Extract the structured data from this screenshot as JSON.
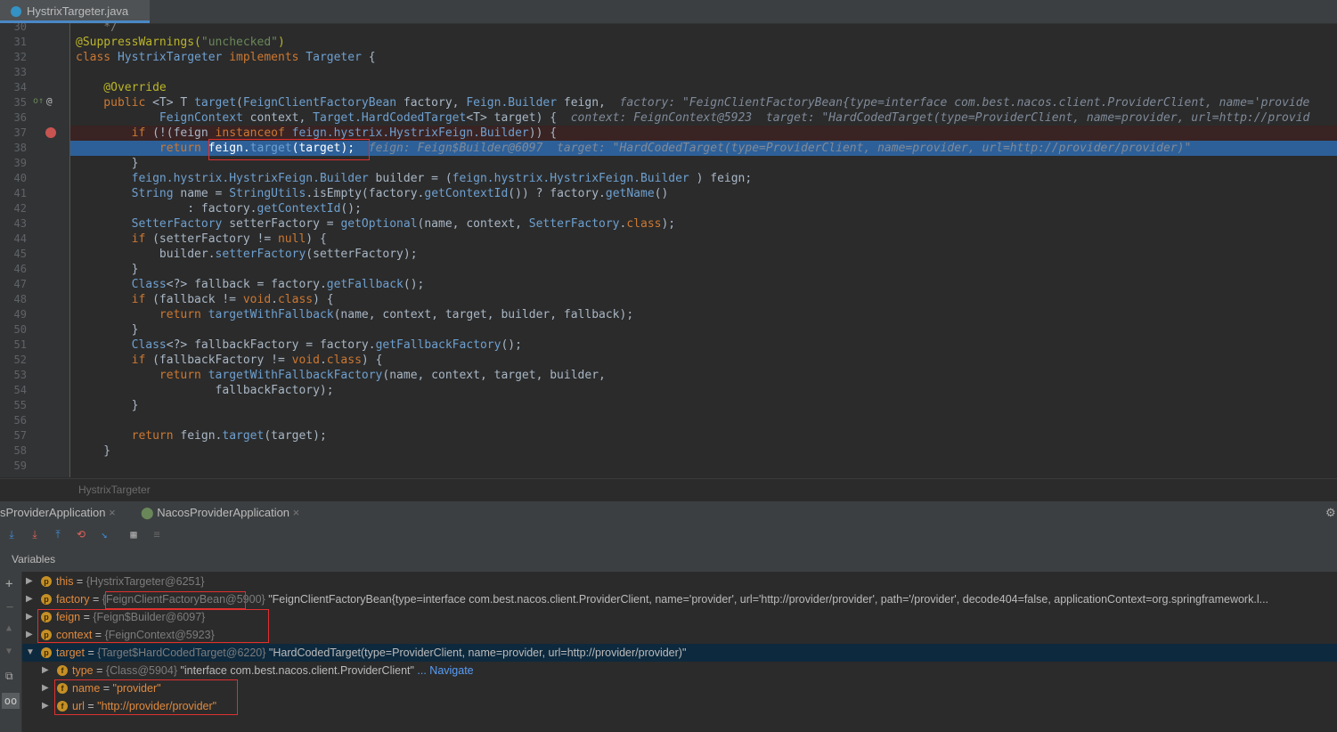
{
  "tab": {
    "file": "HystrixTargeter.java"
  },
  "lines": [
    {
      "n": "30",
      "parts": [
        [
          "cm",
          "    */"
        ]
      ]
    },
    {
      "n": "31",
      "parts": [
        [
          "an",
          "@SuppressWarnings("
        ],
        [
          "st",
          "\"unchecked\""
        ],
        [
          "an",
          ")"
        ]
      ]
    },
    {
      "n": "32",
      "parts": [
        [
          "kw",
          "class "
        ],
        [
          "ty2",
          "HystrixTargeter "
        ],
        [
          "kw",
          "implements "
        ],
        [
          "ty2",
          "Targeter "
        ],
        [
          "",
          "{"
        ]
      ]
    },
    {
      "n": "33",
      "parts": []
    },
    {
      "n": "34",
      "parts": [
        [
          "an",
          "    @Override"
        ]
      ]
    },
    {
      "n": "35",
      "parts": [
        [
          "kw",
          "    public "
        ],
        [
          "",
          "<T> T "
        ],
        [
          "ty2",
          "target"
        ],
        [
          "",
          "("
        ],
        [
          "ty2",
          "FeignClientFactoryBean"
        ],
        [
          "",
          " factory, "
        ],
        [
          "ty2",
          "Feign.Builder"
        ],
        [
          "",
          " feign,  "
        ],
        [
          "hint",
          "factory: \"FeignClientFactoryBean{type=interface com.best.nacos.client.ProviderClient, name='provide"
        ]
      ]
    },
    {
      "n": "36",
      "parts": [
        [
          "",
          "            "
        ],
        [
          "ty2",
          "FeignContext"
        ],
        [
          "",
          " context, "
        ],
        [
          "ty2",
          "Target.HardCodedTarget"
        ],
        [
          "",
          "<T> target) {  "
        ],
        [
          "hint",
          "context: FeignContext@5923  target: \"HardCodedTarget(type=ProviderClient, name=provider, url=http://provid"
        ]
      ]
    },
    {
      "n": "37",
      "parts": [
        [
          "kw",
          "        if "
        ],
        [
          "",
          "(!(feign "
        ],
        [
          "kw",
          "instanceof "
        ],
        [
          "ty2",
          "feign.hystrix.HystrixFeign.Builder"
        ],
        [
          "",
          ")) {"
        ]
      ]
    },
    {
      "n": "38",
      "parts": [
        [
          "kw",
          "            return "
        ],
        [
          "",
          "feign."
        ],
        [
          "ty2",
          "target"
        ],
        [
          "",
          "(target);  "
        ],
        [
          "hint",
          "feign: Feign$Builder@6097  target: \"HardCodedTarget(type=ProviderClient, name=provider, url=http://provider/provider)\""
        ]
      ]
    },
    {
      "n": "39",
      "parts": [
        [
          "",
          "        }"
        ]
      ]
    },
    {
      "n": "40",
      "parts": [
        [
          "",
          "        "
        ],
        [
          "ty2",
          "feign.hystrix.HystrixFeign.Builder"
        ],
        [
          "",
          " builder = ("
        ],
        [
          "ty2",
          "feign.hystrix.HystrixFeign.Builder"
        ],
        [
          "",
          " ) feign;"
        ]
      ]
    },
    {
      "n": "41",
      "parts": [
        [
          "",
          "        "
        ],
        [
          "ty2",
          "String"
        ],
        [
          "",
          " name = "
        ],
        [
          "ty2",
          "StringUtils"
        ],
        [
          "",
          ".isEmpty(factory."
        ],
        [
          "ty2",
          "getContextId"
        ],
        [
          "",
          "()) ? factory."
        ],
        [
          "ty2",
          "getName"
        ],
        [
          "",
          "()"
        ]
      ]
    },
    {
      "n": "42",
      "parts": [
        [
          "",
          "                : factory."
        ],
        [
          "ty2",
          "getContextId"
        ],
        [
          "",
          "();"
        ]
      ]
    },
    {
      "n": "43",
      "parts": [
        [
          "",
          "        "
        ],
        [
          "ty2",
          "SetterFactory"
        ],
        [
          "",
          " setterFactory = "
        ],
        [
          "ty2",
          "getOptional"
        ],
        [
          "",
          "(name, context, "
        ],
        [
          "ty2",
          "SetterFactory"
        ],
        [
          "",
          "."
        ],
        [
          "kw",
          "class"
        ],
        [
          "",
          ");"
        ]
      ]
    },
    {
      "n": "44",
      "parts": [
        [
          "kw",
          "        if "
        ],
        [
          "",
          "(setterFactory != "
        ],
        [
          "kw",
          "null"
        ],
        [
          "",
          ") {"
        ]
      ]
    },
    {
      "n": "45",
      "parts": [
        [
          "",
          "            builder."
        ],
        [
          "ty2",
          "setterFactory"
        ],
        [
          "",
          "(setterFactory);"
        ]
      ]
    },
    {
      "n": "46",
      "parts": [
        [
          "",
          "        }"
        ]
      ]
    },
    {
      "n": "47",
      "parts": [
        [
          "",
          "        "
        ],
        [
          "ty2",
          "Class"
        ],
        [
          "",
          "<?> fallback = factory."
        ],
        [
          "ty2",
          "getFallback"
        ],
        [
          "",
          "();"
        ]
      ]
    },
    {
      "n": "48",
      "parts": [
        [
          "kw",
          "        if "
        ],
        [
          "",
          "(fallback != "
        ],
        [
          "kw",
          "void"
        ],
        [
          "",
          "."
        ],
        [
          "kw",
          "class"
        ],
        [
          "",
          ") {"
        ]
      ]
    },
    {
      "n": "49",
      "parts": [
        [
          "kw",
          "            return "
        ],
        [
          "ty2",
          "targetWithFallback"
        ],
        [
          "",
          "(name, context, target, builder, fallback);"
        ]
      ]
    },
    {
      "n": "50",
      "parts": [
        [
          "",
          "        }"
        ]
      ]
    },
    {
      "n": "51",
      "parts": [
        [
          "",
          "        "
        ],
        [
          "ty2",
          "Class"
        ],
        [
          "",
          "<?> fallbackFactory = factory."
        ],
        [
          "ty2",
          "getFallbackFactory"
        ],
        [
          "",
          "();"
        ]
      ]
    },
    {
      "n": "52",
      "parts": [
        [
          "kw",
          "        if "
        ],
        [
          "",
          "(fallbackFactory != "
        ],
        [
          "kw",
          "void"
        ],
        [
          "",
          "."
        ],
        [
          "kw",
          "class"
        ],
        [
          "",
          ") {"
        ]
      ]
    },
    {
      "n": "53",
      "parts": [
        [
          "kw",
          "            return "
        ],
        [
          "ty2",
          "targetWithFallbackFactory"
        ],
        [
          "",
          "(name, context, target, builder,"
        ]
      ]
    },
    {
      "n": "54",
      "parts": [
        [
          "",
          "                    fallbackFactory);"
        ]
      ]
    },
    {
      "n": "55",
      "parts": [
        [
          "",
          "        }"
        ]
      ]
    },
    {
      "n": "56",
      "parts": []
    },
    {
      "n": "57",
      "parts": [
        [
          "kw",
          "        return "
        ],
        [
          "",
          "feign."
        ],
        [
          "ty2",
          "target"
        ],
        [
          "",
          "(target);"
        ]
      ]
    },
    {
      "n": "58",
      "parts": [
        [
          "",
          "    }"
        ]
      ]
    },
    {
      "n": "59",
      "parts": []
    }
  ],
  "breadcrumb": "HystrixTargeter",
  "debug_tabs": [
    "sProviderApplication",
    "NacosProviderApplication"
  ],
  "variables_label": "Variables",
  "variables": [
    {
      "indent": 0,
      "icon": "p",
      "arrow": "▶",
      "name": "this",
      "eq": " = ",
      "ref": "{HystrixTargeter@6251}",
      "val": ""
    },
    {
      "indent": 0,
      "icon": "p",
      "arrow": "▶",
      "name": "factory",
      "eq": " = ",
      "ref": "{FeignClientFactoryBean@5900}",
      "val": " \"FeignClientFactoryBean{type=interface com.best.nacos.client.ProviderClient, name='provider', url='http://provider/provider', path='/provider', decode404=false, applicationContext=org.springframework.l..."
    },
    {
      "indent": 0,
      "icon": "p",
      "arrow": "▶",
      "name": "feign",
      "eq": " = ",
      "ref": "{Feign$Builder@6097}",
      "val": ""
    },
    {
      "indent": 0,
      "icon": "p",
      "arrow": "▶",
      "name": "context",
      "eq": " = ",
      "ref": "{FeignContext@5923}",
      "val": ""
    },
    {
      "indent": 0,
      "icon": "p",
      "arrow": "▼",
      "name": "target",
      "eq": " = ",
      "ref": "{Target$HardCodedTarget@6220}",
      "val": " \"HardCodedTarget(type=ProviderClient, name=provider, url=http://provider/provider)\"",
      "selected": true
    },
    {
      "indent": 1,
      "icon": "f",
      "arrow": "▶",
      "name": "type",
      "eq": " = ",
      "ref": "{Class@5904}",
      "val": " \"interface com.best.nacos.client.ProviderClient\"",
      "link": " ... Navigate"
    },
    {
      "indent": 1,
      "icon": "f",
      "arrow": "▶",
      "name": "name",
      "eq": " = ",
      "ref": "",
      "str": "\"provider\"",
      "val": ""
    },
    {
      "indent": 1,
      "icon": "f",
      "arrow": "▶",
      "name": "url",
      "eq": " = ",
      "ref": "",
      "str": "\"http://provider/provider\"",
      "val": ""
    }
  ]
}
